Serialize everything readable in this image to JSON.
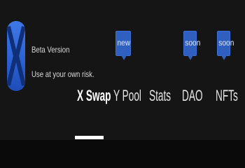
{
  "brand": {
    "title": "Beta Version",
    "subtitle": "Use at your own risk."
  },
  "nav": {
    "items": [
      {
        "label": "X Swap",
        "active": true
      },
      {
        "label": "Y Pool",
        "badge": "new"
      },
      {
        "label": "Stats"
      },
      {
        "label": "DAO",
        "badge": "soon"
      },
      {
        "label": "NFTs",
        "badge": "soon"
      }
    ]
  },
  "colors": {
    "background": "#151516",
    "accent": "#2f5fbf",
    "text": "#e6e6e6"
  },
  "icons": {
    "logo": "x-logo-icon"
  }
}
